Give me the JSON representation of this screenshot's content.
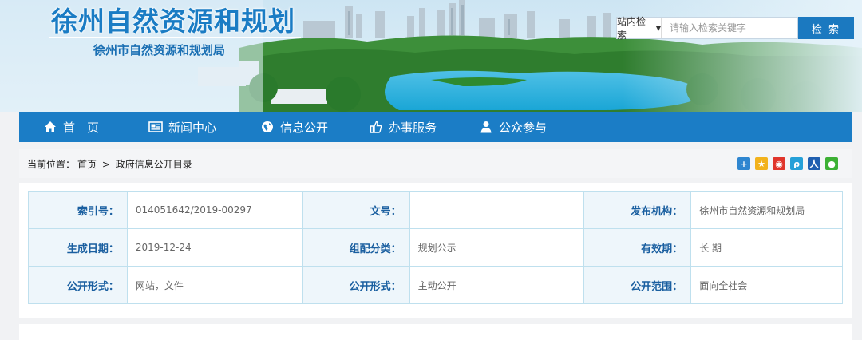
{
  "header": {
    "site_title": "徐州自然资源和规划",
    "site_subtitle": "徐州市自然资源和规划局"
  },
  "search": {
    "scope_label": "站内检索",
    "placeholder": "请输入检索关键字",
    "button_label": "检 索"
  },
  "nav": {
    "items": [
      {
        "label": "首　页",
        "icon": "home-icon"
      },
      {
        "label": "新闻中心",
        "icon": "newspaper-icon"
      },
      {
        "label": "信息公开",
        "icon": "globe-icon"
      },
      {
        "label": "办事服务",
        "icon": "thumbs-up-icon"
      },
      {
        "label": "公众参与",
        "icon": "user-icon"
      }
    ]
  },
  "breadcrumb": {
    "prefix": "当前位置：",
    "home": "首页",
    "separator": ">",
    "current": "政府信息公开目录"
  },
  "share_icons": [
    "plus-share-icon",
    "qzone-icon",
    "weibo-icon",
    "tencent-weibo-icon",
    "renren-icon",
    "wechat-icon"
  ],
  "colors": {
    "nav_bg": "#1b7dc6",
    "title_blue": "#1a7cc4",
    "label_blue": "#1a5fa0"
  },
  "info_table": {
    "rows": [
      [
        {
          "label": "索引号：",
          "value": "014051642/2019-00297"
        },
        {
          "label": "文号：",
          "value": ""
        },
        {
          "label": "发布机构：",
          "value": "徐州市自然资源和规划局"
        }
      ],
      [
        {
          "label": "生成日期：",
          "value": "2019-12-24"
        },
        {
          "label": "组配分类：",
          "value": "规划公示"
        },
        {
          "label": "有效期：",
          "value": "长 期"
        }
      ],
      [
        {
          "label": "公开形式：",
          "value": "网站，文件"
        },
        {
          "label": "公开形式：",
          "value": "主动公开"
        },
        {
          "label": "公开范围：",
          "value": "面向全社会"
        }
      ]
    ]
  }
}
